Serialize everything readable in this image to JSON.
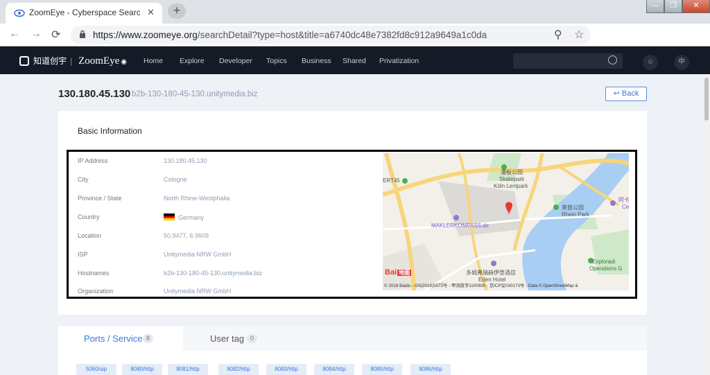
{
  "browser": {
    "tab_title": "ZoomEye - Cyberspace Search En",
    "tab_close": "✕",
    "new_tab": "+",
    "window_minimize": "—",
    "window_restore": "❐",
    "window_close": "✕",
    "url_prefix": "https://www.zoomeye.org",
    "url_rest": "/searchDetail?type=host&title=a6740dc48e7382fd8c912a9649a1c0da",
    "nav_back": "←",
    "nav_forward": "→",
    "nav_reload": "⟳",
    "zoom_icon": "search-icon",
    "star_icon": "star-icon"
  },
  "site": {
    "logo_cn": "知道创宇",
    "logo_brand": "ZoomEye",
    "nav": [
      "Home",
      "Explore",
      "Developer",
      "Topics",
      "Business",
      "Shared",
      "Privatization"
    ],
    "lang_btn": "中"
  },
  "host": {
    "ip": "130.180.45.130",
    "hostname": "b2b-130-180-45-130.unitymedia.biz",
    "back_label": "↩ Back"
  },
  "basic": {
    "title": "Basic Information",
    "rows": [
      {
        "label": "IP Address",
        "value": "130.180.45.130"
      },
      {
        "label": "City",
        "value": "Cologne"
      },
      {
        "label": "Province / State",
        "value": "North Rhine-Westphalia"
      },
      {
        "label": "Country",
        "value": "Germany"
      },
      {
        "label": "Location",
        "value": "50.9477, 6.9609"
      },
      {
        "label": "ISP",
        "value": "Unitymedia NRW GmbH"
      },
      {
        "label": "Hostnames",
        "value": "b2b-130-180-45-130.unitymedia.biz"
      },
      {
        "label": "Organization",
        "value": "Unitymedia NRW GmbH"
      }
    ]
  },
  "map": {
    "labels": [
      "ERT45",
      "潘板公园",
      "Skatepark",
      "Köln Lentpark",
      "莱茵公园",
      "Rhein Park",
      "MAKLERKOMPASS.de",
      "多姆弗瑞赫伊登酒店",
      "Eden Hotel",
      "Exploradi",
      "Operations G",
      "阿卡",
      "Ce"
    ],
    "baidu_logo": "Bai",
    "baidu_logo_cn": "地图",
    "copyright": "© 2018 Baidu - GS(2018)5572号 - 甲测资字1100930 - 京ICP证030173号 - Data © OpenStreetMap & "
  },
  "ports": {
    "tab_label": "Ports / Service",
    "tab_count": "8",
    "user_tag_label": "User tag",
    "user_tag_count": "0",
    "chips": [
      "5060/sip",
      "8080/http",
      "8081/http",
      "8082/http",
      "8083/http",
      "8084/http",
      "8085/http",
      "8086/http"
    ]
  }
}
